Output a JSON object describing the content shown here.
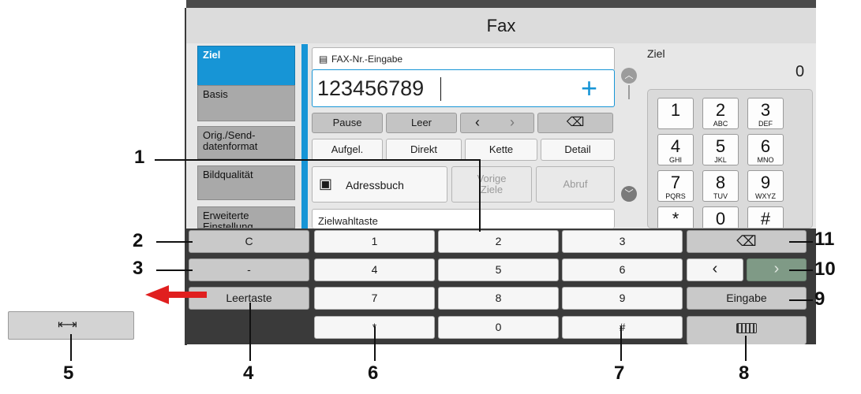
{
  "window": {
    "title": "Fax"
  },
  "sidebar": {
    "items": [
      {
        "label": "Ziel"
      },
      {
        "label": "Basis"
      },
      {
        "label": "Orig./Send-\ndatenformat"
      },
      {
        "label": "Bildqualität"
      },
      {
        "label": "Erweiterte\nEinstellung"
      }
    ]
  },
  "fax_entry": {
    "header": "FAX-Nr.-Eingabe",
    "value": "123456789",
    "add_symbol": "+"
  },
  "dial_row": {
    "pause": "Pause",
    "space": "Leer",
    "left": "‹",
    "right": "›",
    "backspace": "⌫"
  },
  "mode_row": {
    "onhook": "Aufgel.",
    "direct": "Direkt",
    "chain": "Kette",
    "detail": "Detail"
  },
  "dest_row": {
    "addressbook": "Adressbuch",
    "previous": "Vorige\nZiele",
    "poll": "Abruf"
  },
  "speed_dial": "Zielwahltaste",
  "destination": {
    "label": "Ziel",
    "count": "0"
  },
  "keypad": [
    {
      "d": "1",
      "l": ""
    },
    {
      "d": "2",
      "l": "ABC"
    },
    {
      "d": "3",
      "l": "DEF"
    },
    {
      "d": "4",
      "l": "GHI"
    },
    {
      "d": "5",
      "l": "JKL"
    },
    {
      "d": "6",
      "l": "MNO"
    },
    {
      "d": "7",
      "l": "PQRS"
    },
    {
      "d": "8",
      "l": "TUV"
    },
    {
      "d": "9",
      "l": "WXYZ"
    },
    {
      "d": "*",
      "l": ""
    },
    {
      "d": "0",
      "l": ""
    },
    {
      "d": "#",
      "l": ""
    }
  ],
  "keyboard": {
    "clear": "C",
    "dash": "-",
    "space": "Leertaste",
    "keys": [
      "1",
      "2",
      "3",
      "4",
      "5",
      "6",
      "7",
      "8",
      "9",
      "*",
      "0",
      "#"
    ],
    "backspace": "⌫",
    "left": "‹",
    "right": "›",
    "enter": "Eingabe"
  },
  "tab_key": {
    "symbol": "⇤⇥"
  },
  "callouts": [
    "1",
    "2",
    "3",
    "4",
    "5",
    "6",
    "7",
    "8",
    "9",
    "10",
    "11"
  ]
}
